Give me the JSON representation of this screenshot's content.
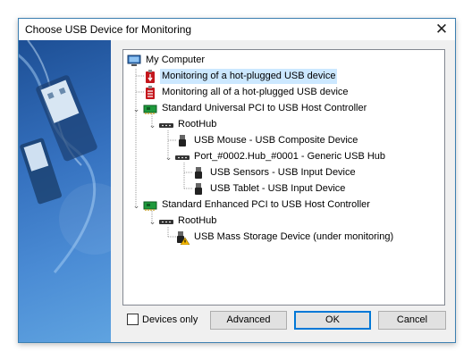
{
  "window": {
    "title": "Choose USB Device for Monitoring",
    "close_glyph": "✕"
  },
  "tree": {
    "root": "My Computer",
    "items": [
      {
        "label": "Monitoring of a hot-plugged USB device",
        "icon": "hotplug-usb-icon"
      },
      {
        "label": "Monitoring all of a hot-plugged USB device",
        "icon": "hotplug-all-usb-icon"
      },
      {
        "label": "Standard Universal PCI to USB Host Controller",
        "icon": "pci-controller-icon"
      },
      {
        "label": "RootHub",
        "icon": "usb-hub-icon"
      },
      {
        "label": "USB Mouse - USB Composite Device",
        "icon": "usb-plug-icon"
      },
      {
        "label": "Port_#0002.Hub_#0001 - Generic USB Hub",
        "icon": "usb-hub-icon"
      },
      {
        "label": "USB Sensors - USB Input Device",
        "icon": "usb-plug-icon"
      },
      {
        "label": "USB Tablet - USB Input Device",
        "icon": "usb-plug-icon"
      },
      {
        "label": "Standard Enhanced PCI to USB Host Controller",
        "icon": "pci-controller-icon"
      },
      {
        "label": "RootHub",
        "icon": "usb-hub-icon"
      },
      {
        "label": "USB Mass Storage Device (under monitoring)",
        "icon": "usb-plug-warning-icon"
      }
    ]
  },
  "footer": {
    "devices_only_label": "Devices only",
    "devices_only_checked": false,
    "advanced_label": "Advanced",
    "ok_label": "OK",
    "cancel_label": "Cancel"
  },
  "colors": {
    "accent": "#0078d7",
    "selection": "#cce8ff",
    "side_panel": "#3571bf"
  }
}
